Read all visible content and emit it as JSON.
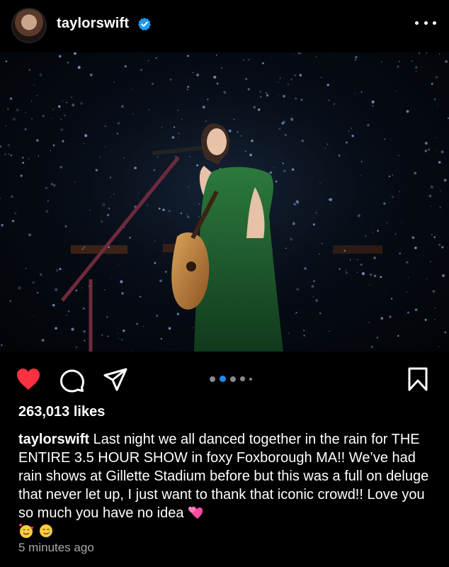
{
  "post": {
    "username": "taylorswift",
    "verified": true,
    "avatar_alt": "profile photo",
    "likes_text": "263,013 likes",
    "caption_user": "taylorswift",
    "caption_text": "Last night we all danced together in the rain for THE ENTIRE 3.5 HOUR SHOW in foxy Foxborough MA!! We’ve had rain shows at Gillette Stadium before but this was a full on deluge that never let up, I just want to thank that iconic crowd!! Love you so much you have no idea",
    "caption_emojis": [
      "two-hearts-emoji",
      "smiling-face-with-hearts-emoji",
      "smiling-face-with-tear-emoji"
    ],
    "timestamp": "5 minutes ago",
    "carousel": {
      "total": 5,
      "active_index": 1
    }
  },
  "icons": {
    "more": "more-options-icon",
    "like": "heart-icon",
    "comment": "comment-icon",
    "share": "share-icon",
    "save": "bookmark-icon"
  },
  "colors": {
    "background": "#000000",
    "like_red": "#ff3040",
    "verified_blue": "#1d9bf0",
    "carousel_active": "#1d8cf8",
    "secondary_text": "#a8a8a8",
    "dress_green": "#1f5a2e"
  }
}
